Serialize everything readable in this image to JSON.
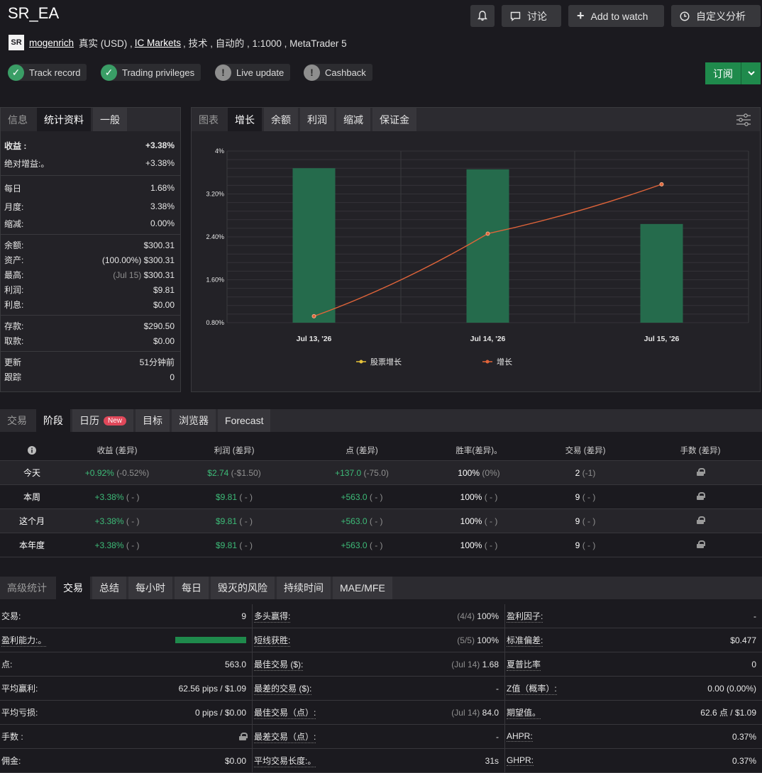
{
  "header": {
    "title": "SR_EA",
    "buttons": {
      "discuss": "讨论",
      "watch": "Add to watch",
      "custom": "自定义分析"
    },
    "logo_text": "SR",
    "username": "mogenrich",
    "account_pre": "真实 (USD) ,",
    "broker": "IC Markets",
    "account_post": ", 技术 , 自动的 , 1:1000 , MetaTrader 5",
    "badges": [
      "Track record",
      "Trading privileges",
      "Live update",
      "Cashback"
    ],
    "subscribe": "订阅"
  },
  "left_panel": {
    "tabs": [
      "信息",
      "统计资料",
      "一般"
    ],
    "stats": {
      "gain_k": "收益 :",
      "gain_v": "+3.38%",
      "abs_k": "绝对增益:。",
      "abs_v": "+3.38%",
      "daily_k": "每日",
      "daily_v": "1.68%",
      "monthly_k": "月度:",
      "monthly_v": "3.38%",
      "dd_k": "缩减:",
      "dd_v": "0.00%",
      "balance_k": "余额:",
      "balance_v": "$300.31",
      "equity_k": "资产:",
      "equity_pct": "(100.00%)",
      "equity_v": "$300.31",
      "high_k": "最高:",
      "high_date": "(Jul 15)",
      "high_v": "$300.31",
      "profit_k": "利润:",
      "profit_v": "$9.81",
      "interest_k": "利息:",
      "interest_v": "$0.00",
      "deposits_k": "存款:",
      "deposits_v": "$290.50",
      "withdraw_k": "取款:",
      "withdraw_v": "$0.00",
      "updated_k": "更新",
      "updated_v": "51分钟前",
      "track_k": "跟踪",
      "track_v": "0"
    }
  },
  "chart_panel": {
    "tabs": [
      "图表",
      "增长",
      "余额",
      "利润",
      "缩减",
      "保证金"
    ],
    "legend": [
      "股票增长",
      "增长"
    ]
  },
  "chart_data": {
    "type": "bar",
    "categories": [
      "Jul 13, '26",
      "Jul 14, '26",
      "Jul 15, '26"
    ],
    "ylim": [
      0.8,
      4
    ],
    "y_ticks": [
      "4%",
      "3.20%",
      "2.40%",
      "1.60%",
      "0.80%"
    ],
    "y_tick_values": [
      4,
      3.2,
      2.4,
      1.6,
      0.8
    ],
    "series": [
      {
        "name": "股票增长",
        "type": "bar",
        "values": [
          3.68,
          3.66,
          2.64
        ],
        "color": "#256b4c"
      },
      {
        "name": "增长",
        "type": "line",
        "values": [
          0.92,
          2.46,
          3.38
        ],
        "color": "#e0643a"
      }
    ],
    "grid": true,
    "legend_position": "bottom"
  },
  "period_tabs": [
    "交易",
    "阶段",
    "日历",
    "目标",
    "浏览器",
    "Forecast"
  ],
  "new_label": "New",
  "period_table": {
    "headers": [
      "收益 (差异)",
      "利润 (差异)",
      "点 (差异)",
      "胜率(差异)。",
      "交易 (差异)",
      "手数 (差异)"
    ],
    "rows": [
      {
        "label": "今天",
        "gain": "+0.92%",
        "gain_d": "(-0.52%)",
        "profit": "$2.74",
        "profit_d": "(-$1.50)",
        "pips": "+137.0",
        "pips_d": "(-75.0)",
        "win": "100%",
        "win_d": "(0%)",
        "trades": "2",
        "trades_d": "(-1)"
      },
      {
        "label": "本周",
        "gain": "+3.38%",
        "gain_d": "( - )",
        "profit": "$9.81",
        "profit_d": "( - )",
        "pips": "+563.0",
        "pips_d": "( - )",
        "win": "100%",
        "win_d": "( - )",
        "trades": "9",
        "trades_d": "( - )"
      },
      {
        "label": "这个月",
        "gain": "+3.38%",
        "gain_d": "( - )",
        "profit": "$9.81",
        "profit_d": "( - )",
        "pips": "+563.0",
        "pips_d": "( - )",
        "win": "100%",
        "win_d": "( - )",
        "trades": "9",
        "trades_d": "( - )"
      },
      {
        "label": "本年度",
        "gain": "+3.38%",
        "gain_d": "( - )",
        "profit": "$9.81",
        "profit_d": "( - )",
        "pips": "+563.0",
        "pips_d": "( - )",
        "win": "100%",
        "win_d": "( - )",
        "trades": "9",
        "trades_d": "( - )"
      }
    ]
  },
  "adv_tabs": [
    "高级统计",
    "交易",
    "总结",
    "每小时",
    "每日",
    "毁灭的风险",
    "持续时间",
    "MAE/MFE"
  ],
  "adv": {
    "c1": [
      {
        "k": "交易:",
        "v": "9"
      },
      {
        "k": "盈利能力:。",
        "v": "",
        "bar": 1.0
      },
      {
        "k": "点:",
        "v": "563.0"
      },
      {
        "k": "平均赢利:",
        "v": "62.56 pips / $1.09"
      },
      {
        "k": "平均亏损:",
        "v": "0 pips / $0.00"
      },
      {
        "k": "手数 :",
        "v": "",
        "lock": true
      },
      {
        "k": "佣金:",
        "v": "$0.00"
      }
    ],
    "c2": [
      {
        "k": "多头赢得:",
        "pre": "(4/4)",
        "v": "100%"
      },
      {
        "k": "短线获胜:",
        "pre": "(5/5)",
        "v": "100%"
      },
      {
        "k": "最佳交易 ($):",
        "pre": "(Jul 14)",
        "v": "1.68"
      },
      {
        "k": "最差的交易 ($):",
        "pre": "",
        "v": "-"
      },
      {
        "k": "最佳交易（点）:",
        "pre": "(Jul 14)",
        "v": "84.0"
      },
      {
        "k": "最差交易（点）:",
        "pre": "",
        "v": "-"
      },
      {
        "k": "平均交易长度:。",
        "pre": "",
        "v": "31s"
      }
    ],
    "c3": [
      {
        "k": "盈利因子:",
        "v": "-"
      },
      {
        "k": "标准偏差:",
        "v": "$0.477"
      },
      {
        "k": "夏普比率",
        "v": "0"
      },
      {
        "k": "Z值（概率）:",
        "v": "0.00 (0.00%)"
      },
      {
        "k": "期望值。",
        "v": "62.6 点 / $1.09"
      },
      {
        "k": "AHPR:",
        "v": "0.37%"
      },
      {
        "k": "GHPR:",
        "v": "0.37%"
      }
    ]
  },
  "colors": {
    "accent_green": "#3dbb78",
    "bar_green": "#256b4c",
    "line_orange": "#e0643a",
    "subscribe": "#1f8a4c"
  }
}
